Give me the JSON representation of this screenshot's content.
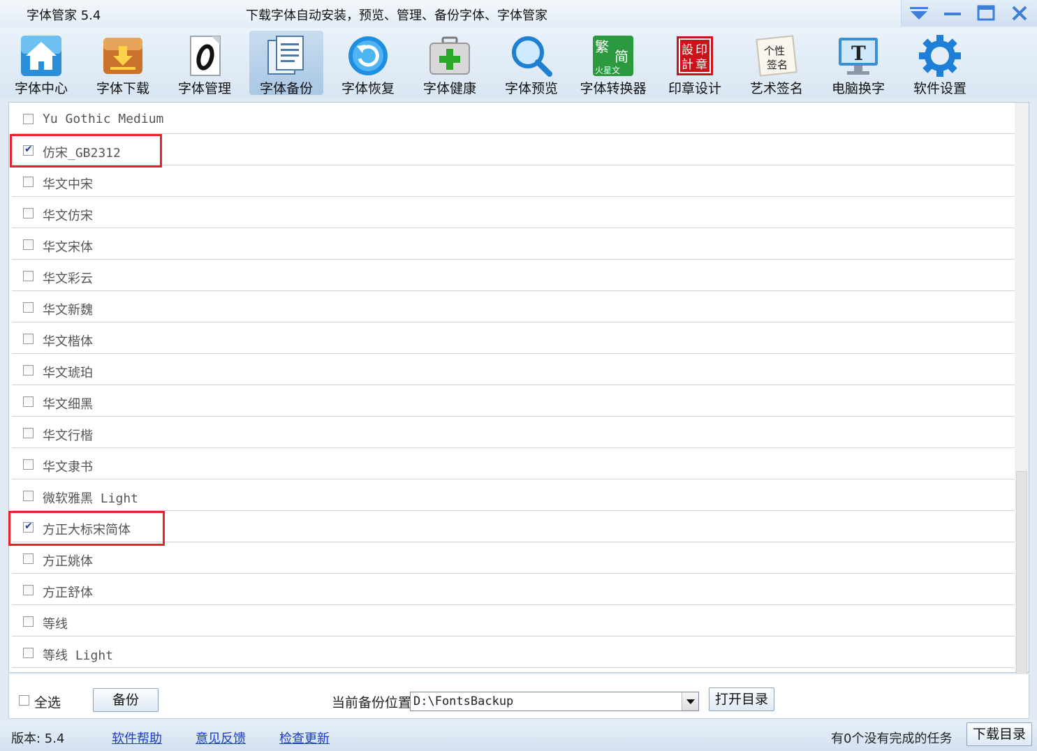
{
  "titlebar": {
    "app_title": "字体管家 5.4",
    "slogan": "下载字体自动安装，预览、管理、备份字体、字体管家"
  },
  "toolbar": {
    "items": [
      {
        "label": "字体中心",
        "icon": "house-icon"
      },
      {
        "label": "字体下载",
        "icon": "download-box-icon"
      },
      {
        "label": "字体管理",
        "icon": "font-page-icon"
      },
      {
        "label": "字体备份",
        "icon": "backup-document-icon"
      },
      {
        "label": "字体恢复",
        "icon": "restore-arrow-icon"
      },
      {
        "label": "字体健康",
        "icon": "medical-kit-icon"
      },
      {
        "label": "字体预览",
        "icon": "magnifier-icon"
      },
      {
        "label": "字体转换器",
        "icon": "converter-icon"
      },
      {
        "label": "印章设计",
        "icon": "seal-stamp-icon"
      },
      {
        "label": "艺术签名",
        "icon": "signature-icon"
      },
      {
        "label": "电脑换字",
        "icon": "monitor-font-icon"
      },
      {
        "label": "软件设置",
        "icon": "gear-icon"
      }
    ],
    "converter_icon_text": {
      "trad": "繁",
      "simp": "简",
      "mars": "火星文"
    },
    "seal_icon_text": [
      "設",
      "印",
      "計",
      "章"
    ],
    "signature_icon_text": [
      "个性",
      "签名"
    ],
    "monitor_icon_text": "T",
    "active": "字体备份"
  },
  "font_list": [
    {
      "name": "Yu Gothic Medium",
      "checked": false
    },
    {
      "name": "仿宋_GB2312",
      "checked": true
    },
    {
      "name": "华文中宋",
      "checked": false
    },
    {
      "name": "华文仿宋",
      "checked": false
    },
    {
      "name": "华文宋体",
      "checked": false
    },
    {
      "name": "华文彩云",
      "checked": false
    },
    {
      "name": "华文新魏",
      "checked": false
    },
    {
      "name": "华文楷体",
      "checked": false
    },
    {
      "name": "华文琥珀",
      "checked": false
    },
    {
      "name": "华文细黑",
      "checked": false
    },
    {
      "name": "华文行楷",
      "checked": false
    },
    {
      "name": "华文隶书",
      "checked": false
    },
    {
      "name": "微软雅黑 Light",
      "checked": false
    },
    {
      "name": "方正大标宋简体",
      "checked": true
    },
    {
      "name": "方正姚体",
      "checked": false
    },
    {
      "name": "方正舒体",
      "checked": false
    },
    {
      "name": "等线",
      "checked": false
    },
    {
      "name": "等线 Light",
      "checked": false
    }
  ],
  "controls": {
    "select_all_label": "全选",
    "backup_button": "备份",
    "backup_location_label": "当前备份位置",
    "backup_path": "D:\\FontsBackup",
    "open_dir_button": "打开目录"
  },
  "statusbar": {
    "version": "版本: 5.4",
    "help_link": "软件帮助",
    "feedback_link": "意见反馈",
    "update_link": "检查更新",
    "tasks_text": "有0个没有完成的任务",
    "download_dir_button": "下载目录"
  },
  "colors": {
    "highlight_border": "#e8202a",
    "link": "#1a3cc8",
    "checkmark": "#1f3fa8"
  }
}
